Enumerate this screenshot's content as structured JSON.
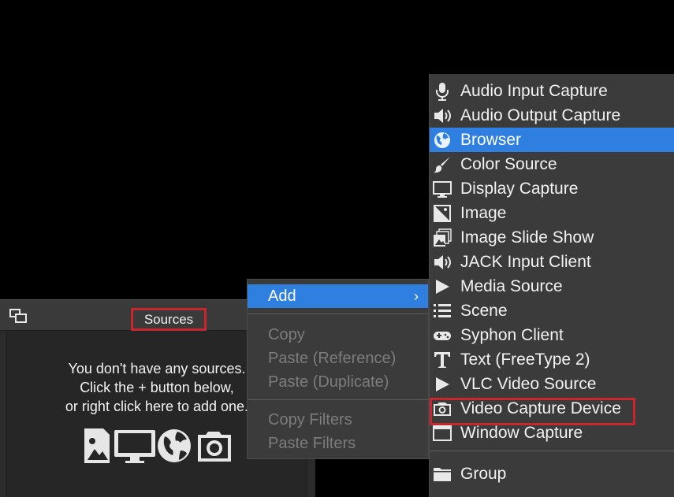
{
  "dock": {
    "title": "Sources",
    "empty_lines": [
      "You don't have any sources.",
      "Click the + button below,",
      "or right click here to add one."
    ]
  },
  "context_menu": {
    "add_label": "Add",
    "add_arrow": "›",
    "copy": "Copy",
    "paste_reference": "Paste (Reference)",
    "paste_duplicate": "Paste (Duplicate)",
    "copy_filters": "Copy Filters",
    "paste_filters": "Paste Filters"
  },
  "submenu": {
    "items": [
      {
        "label": "Audio Input Capture",
        "icon": "microphone-icon"
      },
      {
        "label": "Audio Output Capture",
        "icon": "speaker-icon"
      },
      {
        "label": "Browser",
        "icon": "globe-icon",
        "selected": true
      },
      {
        "label": "Color Source",
        "icon": "brush-icon"
      },
      {
        "label": "Display Capture",
        "icon": "monitor-icon"
      },
      {
        "label": "Image",
        "icon": "image-icon"
      },
      {
        "label": "Image Slide Show",
        "icon": "slideshow-icon"
      },
      {
        "label": "JACK Input Client",
        "icon": "speaker-icon"
      },
      {
        "label": "Media Source",
        "icon": "play-icon"
      },
      {
        "label": "Scene",
        "icon": "list-icon"
      },
      {
        "label": "Syphon Client",
        "icon": "gamepad-icon"
      },
      {
        "label": "Text (FreeType 2)",
        "icon": "text-icon"
      },
      {
        "label": "VLC Video Source",
        "icon": "play-icon"
      },
      {
        "label": "Video Capture Device",
        "icon": "camera-icon",
        "highlighted": true
      },
      {
        "label": "Window Capture",
        "icon": "window-icon"
      }
    ],
    "group_label": "Group"
  },
  "colors": {
    "selection": "#2f7fe0",
    "highlight_box": "#c8252c",
    "menu_bg": "#3b3b3c",
    "disabled_text": "#7c7c7c"
  }
}
